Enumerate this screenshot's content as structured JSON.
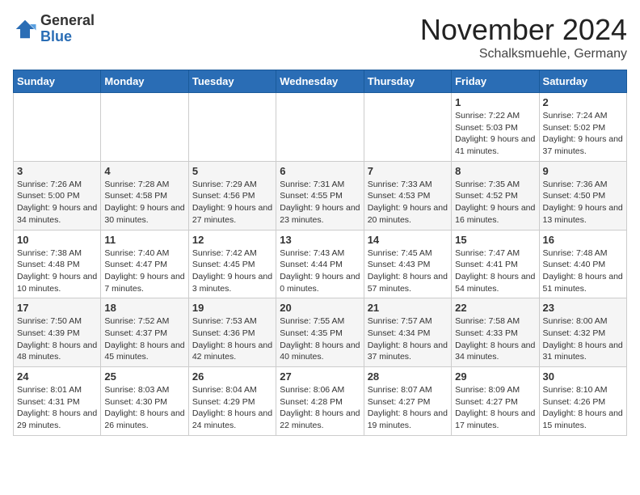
{
  "logo": {
    "general": "General",
    "blue": "Blue"
  },
  "title": "November 2024",
  "subtitle": "Schalksmuehle, Germany",
  "days_of_week": [
    "Sunday",
    "Monday",
    "Tuesday",
    "Wednesday",
    "Thursday",
    "Friday",
    "Saturday"
  ],
  "weeks": [
    [
      {
        "day": "",
        "info": ""
      },
      {
        "day": "",
        "info": ""
      },
      {
        "day": "",
        "info": ""
      },
      {
        "day": "",
        "info": ""
      },
      {
        "day": "",
        "info": ""
      },
      {
        "day": "1",
        "info": "Sunrise: 7:22 AM\nSunset: 5:03 PM\nDaylight: 9 hours and 41 minutes."
      },
      {
        "day": "2",
        "info": "Sunrise: 7:24 AM\nSunset: 5:02 PM\nDaylight: 9 hours and 37 minutes."
      }
    ],
    [
      {
        "day": "3",
        "info": "Sunrise: 7:26 AM\nSunset: 5:00 PM\nDaylight: 9 hours and 34 minutes."
      },
      {
        "day": "4",
        "info": "Sunrise: 7:28 AM\nSunset: 4:58 PM\nDaylight: 9 hours and 30 minutes."
      },
      {
        "day": "5",
        "info": "Sunrise: 7:29 AM\nSunset: 4:56 PM\nDaylight: 9 hours and 27 minutes."
      },
      {
        "day": "6",
        "info": "Sunrise: 7:31 AM\nSunset: 4:55 PM\nDaylight: 9 hours and 23 minutes."
      },
      {
        "day": "7",
        "info": "Sunrise: 7:33 AM\nSunset: 4:53 PM\nDaylight: 9 hours and 20 minutes."
      },
      {
        "day": "8",
        "info": "Sunrise: 7:35 AM\nSunset: 4:52 PM\nDaylight: 9 hours and 16 minutes."
      },
      {
        "day": "9",
        "info": "Sunrise: 7:36 AM\nSunset: 4:50 PM\nDaylight: 9 hours and 13 minutes."
      }
    ],
    [
      {
        "day": "10",
        "info": "Sunrise: 7:38 AM\nSunset: 4:48 PM\nDaylight: 9 hours and 10 minutes."
      },
      {
        "day": "11",
        "info": "Sunrise: 7:40 AM\nSunset: 4:47 PM\nDaylight: 9 hours and 7 minutes."
      },
      {
        "day": "12",
        "info": "Sunrise: 7:42 AM\nSunset: 4:45 PM\nDaylight: 9 hours and 3 minutes."
      },
      {
        "day": "13",
        "info": "Sunrise: 7:43 AM\nSunset: 4:44 PM\nDaylight: 9 hours and 0 minutes."
      },
      {
        "day": "14",
        "info": "Sunrise: 7:45 AM\nSunset: 4:43 PM\nDaylight: 8 hours and 57 minutes."
      },
      {
        "day": "15",
        "info": "Sunrise: 7:47 AM\nSunset: 4:41 PM\nDaylight: 8 hours and 54 minutes."
      },
      {
        "day": "16",
        "info": "Sunrise: 7:48 AM\nSunset: 4:40 PM\nDaylight: 8 hours and 51 minutes."
      }
    ],
    [
      {
        "day": "17",
        "info": "Sunrise: 7:50 AM\nSunset: 4:39 PM\nDaylight: 8 hours and 48 minutes."
      },
      {
        "day": "18",
        "info": "Sunrise: 7:52 AM\nSunset: 4:37 PM\nDaylight: 8 hours and 45 minutes."
      },
      {
        "day": "19",
        "info": "Sunrise: 7:53 AM\nSunset: 4:36 PM\nDaylight: 8 hours and 42 minutes."
      },
      {
        "day": "20",
        "info": "Sunrise: 7:55 AM\nSunset: 4:35 PM\nDaylight: 8 hours and 40 minutes."
      },
      {
        "day": "21",
        "info": "Sunrise: 7:57 AM\nSunset: 4:34 PM\nDaylight: 8 hours and 37 minutes."
      },
      {
        "day": "22",
        "info": "Sunrise: 7:58 AM\nSunset: 4:33 PM\nDaylight: 8 hours and 34 minutes."
      },
      {
        "day": "23",
        "info": "Sunrise: 8:00 AM\nSunset: 4:32 PM\nDaylight: 8 hours and 31 minutes."
      }
    ],
    [
      {
        "day": "24",
        "info": "Sunrise: 8:01 AM\nSunset: 4:31 PM\nDaylight: 8 hours and 29 minutes."
      },
      {
        "day": "25",
        "info": "Sunrise: 8:03 AM\nSunset: 4:30 PM\nDaylight: 8 hours and 26 minutes."
      },
      {
        "day": "26",
        "info": "Sunrise: 8:04 AM\nSunset: 4:29 PM\nDaylight: 8 hours and 24 minutes."
      },
      {
        "day": "27",
        "info": "Sunrise: 8:06 AM\nSunset: 4:28 PM\nDaylight: 8 hours and 22 minutes."
      },
      {
        "day": "28",
        "info": "Sunrise: 8:07 AM\nSunset: 4:27 PM\nDaylight: 8 hours and 19 minutes."
      },
      {
        "day": "29",
        "info": "Sunrise: 8:09 AM\nSunset: 4:27 PM\nDaylight: 8 hours and 17 minutes."
      },
      {
        "day": "30",
        "info": "Sunrise: 8:10 AM\nSunset: 4:26 PM\nDaylight: 8 hours and 15 minutes."
      }
    ]
  ]
}
